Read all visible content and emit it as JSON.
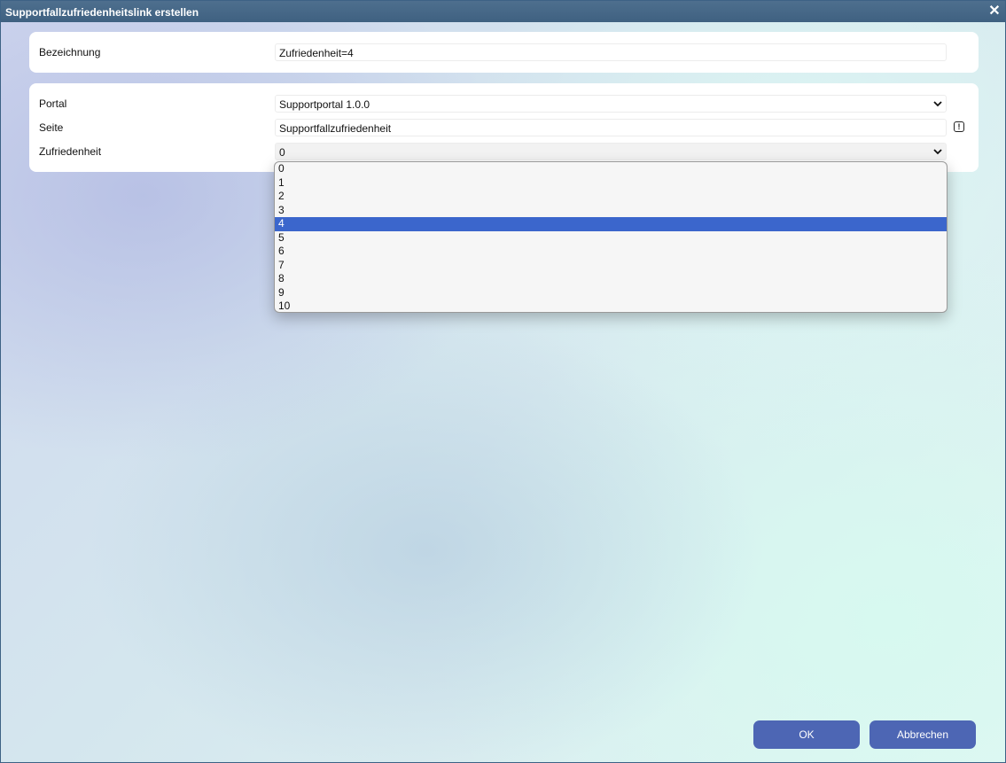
{
  "window": {
    "title": "Supportfallzufriedenheitslink erstellen",
    "close_glyph": "✕"
  },
  "form": {
    "bezeichnung": {
      "label": "Bezeichnung",
      "value": "Zufriedenheit=4"
    },
    "portal": {
      "label": "Portal",
      "value": "Supportportal 1.0.0"
    },
    "seite": {
      "label": "Seite",
      "value": "Supportfallzufriedenheit",
      "info_icon": "exclamation-icon",
      "info_glyph": "!"
    },
    "zufriedenheit": {
      "label": "Zufriedenheit",
      "value": "0",
      "options": [
        "0",
        "1",
        "2",
        "3",
        "4",
        "5",
        "6",
        "7",
        "8",
        "9",
        "10"
      ],
      "highlighted_index": 4
    }
  },
  "buttons": {
    "ok": "OK",
    "cancel": "Abbrechen"
  },
  "colors": {
    "titlebar": "#3f6181",
    "button": "#4d66b4",
    "highlight": "#3b66cc"
  }
}
